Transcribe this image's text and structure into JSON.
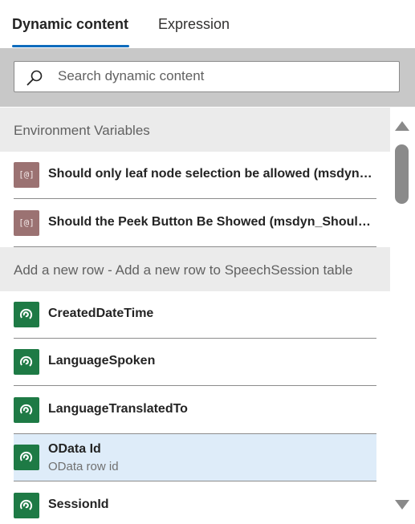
{
  "tabs": [
    {
      "label": "Dynamic content",
      "active": true
    },
    {
      "label": "Expression",
      "active": false
    }
  ],
  "search": {
    "placeholder": "Search dynamic content",
    "value": ""
  },
  "sections": [
    {
      "title": "Environment Variables",
      "items": [
        {
          "title": "Should only leaf node selection be allowed (msdyn_AllowLeafNodeSelectionOnly)",
          "icon": "environment-variable-icon",
          "icon_text": "[@]"
        },
        {
          "title": "Should the Peek Button Be Showed (msdyn_ShouldShowPeekButton)",
          "icon": "environment-variable-icon",
          "icon_text": "[@]"
        }
      ]
    },
    {
      "title": "Add a new row - Add a new row to SpeechSession table",
      "items": [
        {
          "title": "CreatedDateTime",
          "icon": "dataverse-icon"
        },
        {
          "title": "LanguageSpoken",
          "icon": "dataverse-icon"
        },
        {
          "title": "LanguageTranslatedTo",
          "icon": "dataverse-icon"
        },
        {
          "title": "OData Id",
          "subtitle": "OData row id",
          "icon": "dataverse-icon",
          "selected": true
        },
        {
          "title": "SessionId",
          "icon": "dataverse-icon"
        }
      ]
    }
  ],
  "colors": {
    "accent": "#0f6cbd",
    "section_bg": "#ebebeb",
    "selected_bg": "#deecf9",
    "env_icon_bg": "#9b7272",
    "dataverse_icon_bg": "#1e7a45"
  }
}
